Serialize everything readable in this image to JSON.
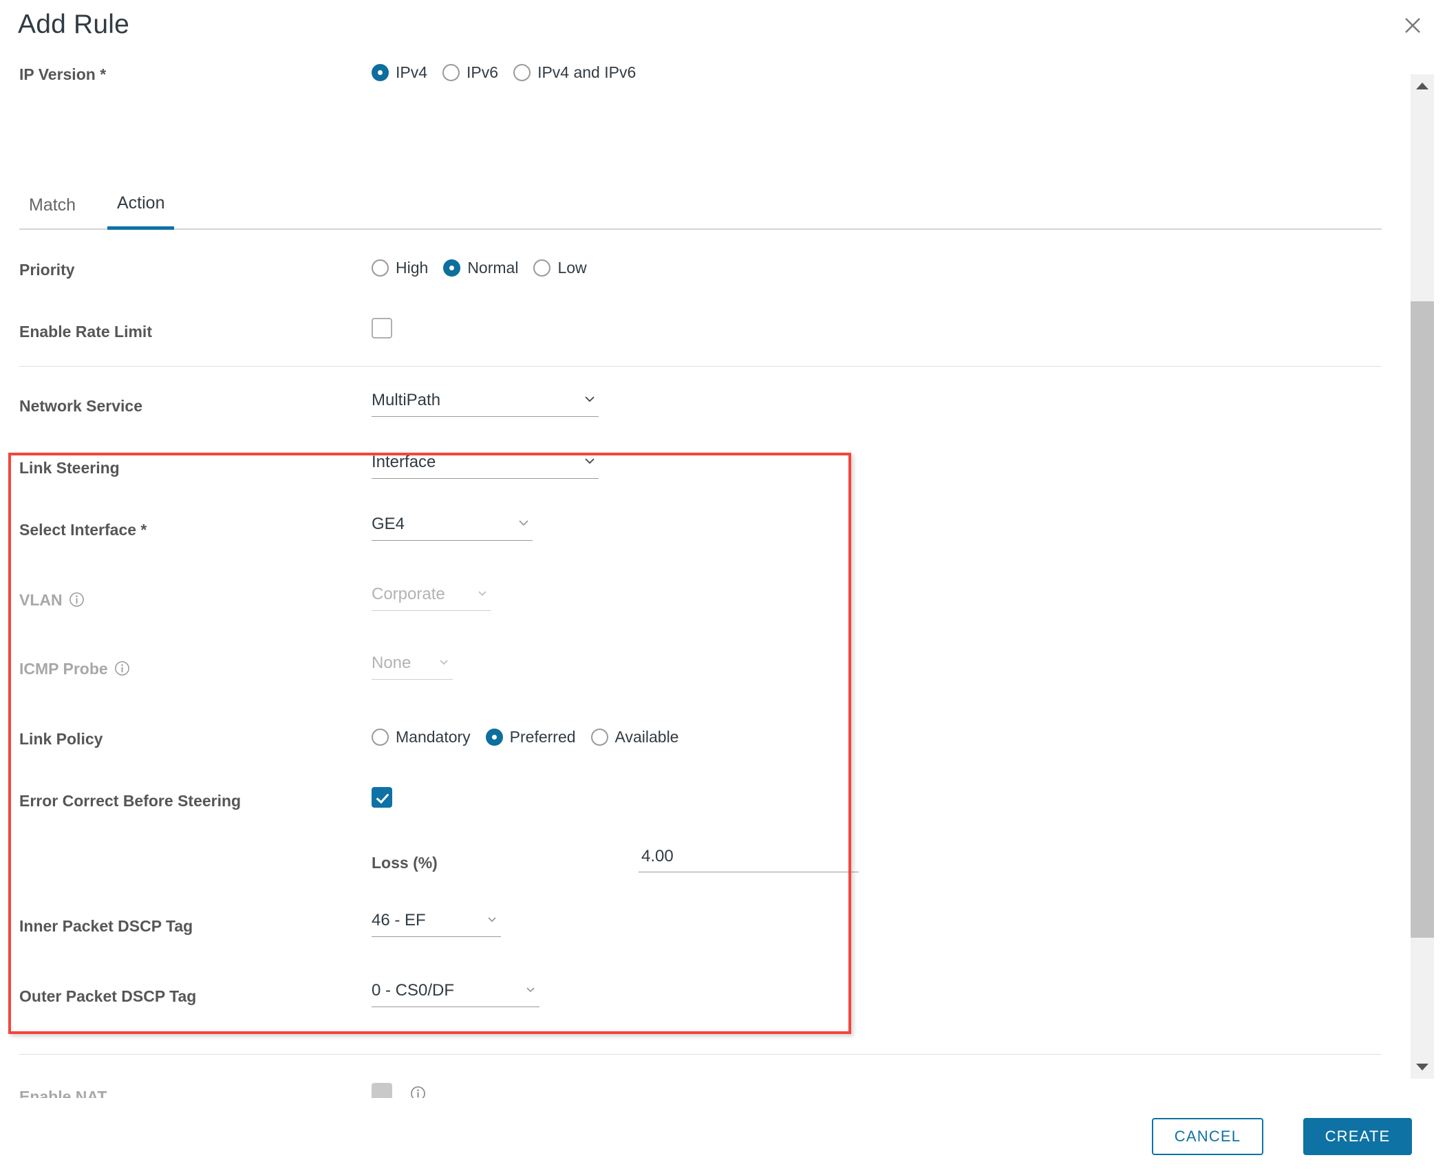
{
  "dialog": {
    "title": "Add Rule",
    "close_icon": "close-icon"
  },
  "ip_version": {
    "label": "IP Version *",
    "options": [
      "IPv4",
      "IPv6",
      "IPv4 and IPv6"
    ],
    "selected": "IPv4"
  },
  "tabs": [
    {
      "label": "Match",
      "active": false
    },
    {
      "label": "Action",
      "active": true
    }
  ],
  "fields": {
    "priority": {
      "label": "Priority",
      "options": [
        "High",
        "Normal",
        "Low"
      ],
      "selected": "Normal"
    },
    "enable_rate_limit": {
      "label": "Enable Rate Limit",
      "checked": false
    },
    "network_service": {
      "label": "Network Service",
      "value": "MultiPath"
    },
    "link_steering": {
      "label": "Link Steering",
      "value": "Interface"
    },
    "select_interface": {
      "label": "Select Interface *",
      "value": "GE4"
    },
    "vlan": {
      "label": "VLAN",
      "value": "Corporate",
      "info_icon": "info-icon",
      "disabled": true
    },
    "icmp_probe": {
      "label": "ICMP Probe",
      "value": "None",
      "info_icon": "info-icon",
      "disabled": true
    },
    "link_policy": {
      "label": "Link Policy",
      "options": [
        "Mandatory",
        "Preferred",
        "Available"
      ],
      "selected": "Preferred"
    },
    "error_correct_before_steering": {
      "label": "Error Correct Before Steering",
      "checked": true
    },
    "loss": {
      "label": "Loss (%)",
      "value": "4.00"
    },
    "inner_dscp": {
      "label": "Inner Packet DSCP Tag",
      "value": "46 - EF"
    },
    "outer_dscp": {
      "label": "Outer Packet DSCP Tag",
      "value": "0 - CS0/DF"
    },
    "enable_nat": {
      "label": "Enable NAT",
      "checked": false,
      "disabled": true,
      "info_icon": "info-icon"
    }
  },
  "footer": {
    "cancel_label": "CANCEL",
    "create_label": "CREATE"
  },
  "colors": {
    "accent": "#0e72a4",
    "highlight": "#f4463c",
    "label": "#565656",
    "disabled": "#b3b3b3"
  },
  "scrollbar": {
    "up_arrow_icon": "triangle-up-icon",
    "down_arrow_icon": "triangle-down-icon"
  }
}
